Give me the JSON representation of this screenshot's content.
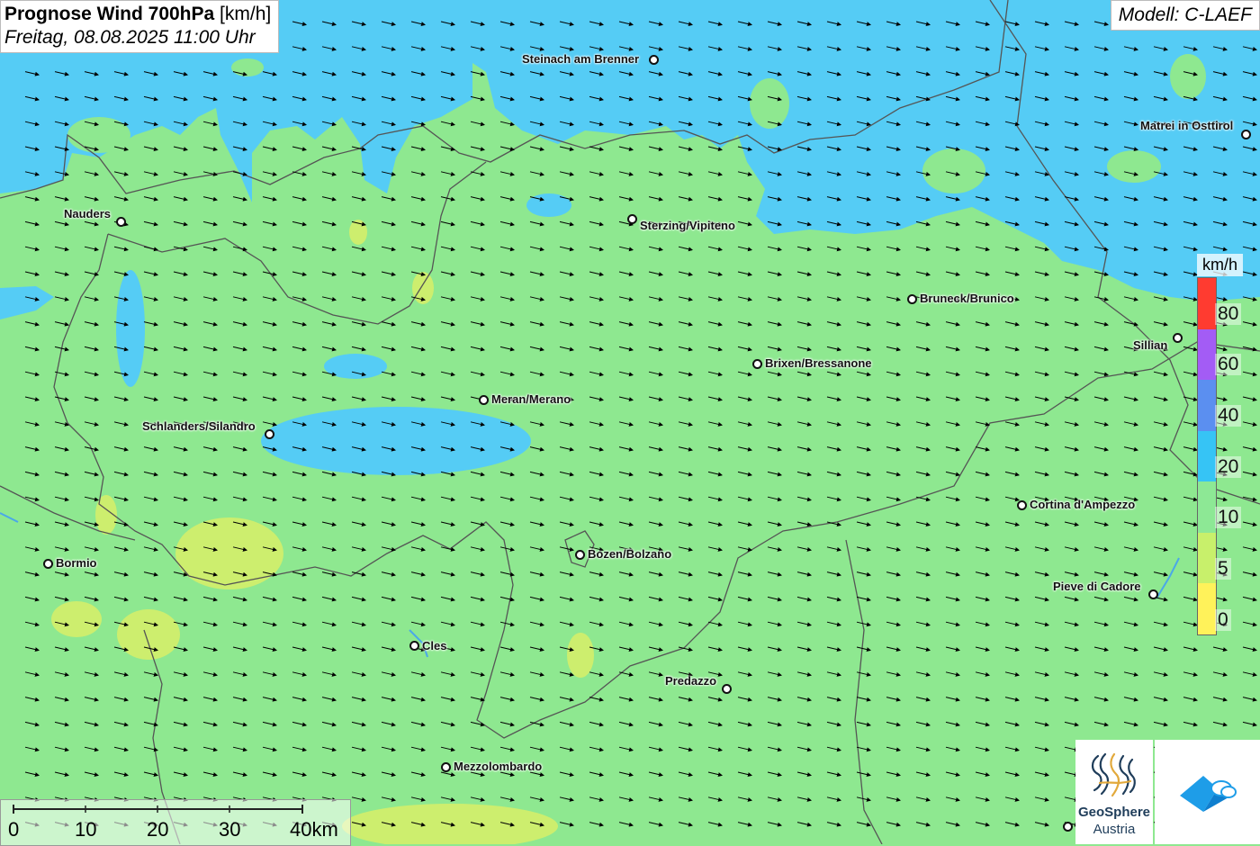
{
  "header": {
    "title_bold": "Prognose Wind 700hPa",
    "title_unit": "[km/h]",
    "date": "Freitag, 08.08.2025 11:00 Uhr",
    "model": "Modell: C-LAEF"
  },
  "legend": {
    "unit": "km/h",
    "labels": [
      "80",
      "60",
      "40",
      "20",
      "10",
      "5",
      "0"
    ],
    "colors": [
      "#ff3b30",
      "#a35cf5",
      "#5b8ff0",
      "#36c4f5",
      "#8de895",
      "#c8f06b",
      "#fff25a"
    ]
  },
  "cities": [
    {
      "name": "Steinach am Brenner"
    },
    {
      "name": "Matrei in Osttirol"
    },
    {
      "name": "Nauders"
    },
    {
      "name": "Sterzing/Vipiteno"
    },
    {
      "name": "Bruneck/Brunico"
    },
    {
      "name": "Sillian"
    },
    {
      "name": "Brixen/Bressanone"
    },
    {
      "name": "Meran/Merano"
    },
    {
      "name": "Schlanders/Silandro"
    },
    {
      "name": "Cortina d'Ampezzo"
    },
    {
      "name": "Bormio"
    },
    {
      "name": "Bozen/Bolzano"
    },
    {
      "name": "Pieve di Cadore"
    },
    {
      "name": "Cles"
    },
    {
      "name": "Predazzo"
    },
    {
      "name": "Mezzolombardo"
    }
  ],
  "scale": {
    "labels": [
      "0",
      "10",
      "20",
      "30",
      "40km"
    ]
  },
  "logos": {
    "geosphere_line1": "GeoSphere",
    "geosphere_line2": "Austria"
  },
  "colors": {
    "land_10_20": "#8ee890",
    "wind_20_40": "#55ccf5",
    "wind_5_10": "#cdee6e",
    "border": "#555555",
    "arrow": "#000000"
  }
}
